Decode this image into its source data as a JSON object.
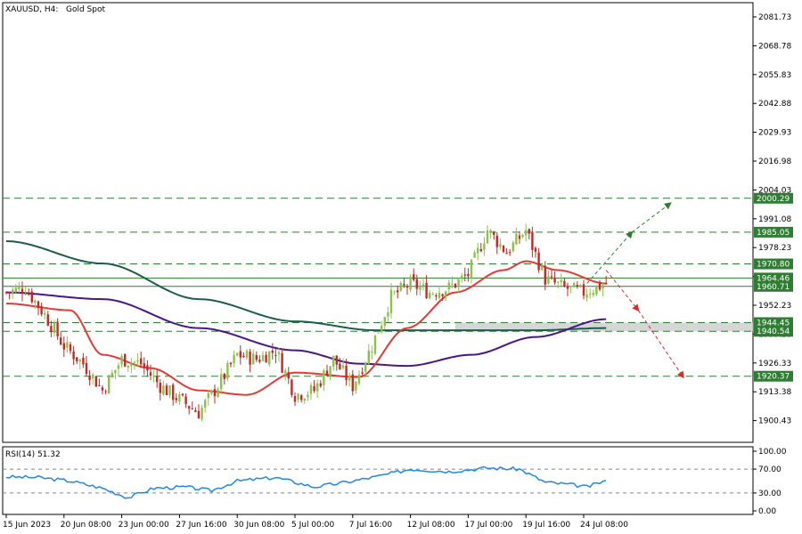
{
  "header": {
    "symbol": "XAUUSD, H4:",
    "description": "Gold Spot"
  },
  "colors": {
    "candle_up": "#8bc34a",
    "candle_down": "#c62828",
    "ma_fast": "#e53935",
    "ma_mid": "#4a148c",
    "ma_slow": "#1b5e4f",
    "level_line": "#2e7d32",
    "badge_fill": "#2e7d32",
    "zone_fill": "#cfcfcf",
    "rsi_line": "#1e88e5",
    "arrow_up": "#2e7d32",
    "arrow_down": "#d32f2f"
  },
  "chart_data": {
    "type": "candlestick",
    "price_axis": {
      "ticks": [
        "2081.73",
        "2068.78",
        "2055.83",
        "2042.88",
        "2029.93",
        "2016.98",
        "2004.03",
        "1991.08",
        "1978.23",
        "1965.28",
        "1952.23",
        "1939.28",
        "1926.33",
        "1913.38",
        "1900.43"
      ],
      "ylim": [
        1888,
        2087
      ]
    },
    "time_axis": {
      "labels": [
        "15 Jun 2023",
        "20 Jun 08:00",
        "23 Jun 00:00",
        "27 Jun 16:00",
        "30 Jun 08:00",
        "5 Jul 00:00",
        "7 Jul 16:00",
        "12 Jul 08:00",
        "17 Jul 00:00",
        "19 Jul 16:00",
        "24 Jul 08:00"
      ]
    },
    "levels": [
      {
        "value": 2000.29,
        "label": "2000.29",
        "style": "dashed"
      },
      {
        "value": 1985.05,
        "label": "1985.05",
        "style": "dashed"
      },
      {
        "value": 1970.8,
        "label": "1970.80",
        "style": "dashed"
      },
      {
        "value": 1964.46,
        "label": "1964.46",
        "style": "solid"
      },
      {
        "value": 1960.71,
        "label": "1960.71",
        "style": "solid"
      },
      {
        "value": 1944.45,
        "label": "1944.45",
        "style": "dashed"
      },
      {
        "value": 1940.54,
        "label": "1940.54",
        "style": "dashed"
      },
      {
        "value": 1920.37,
        "label": "1920.37",
        "style": "dashed"
      }
    ],
    "zone": {
      "from": 1940.54,
      "to": 1944.45
    },
    "anchors": [
      {
        "x": 0,
        "y": 1958
      },
      {
        "x": 6,
        "y": 1960
      },
      {
        "x": 12,
        "y": 1948
      },
      {
        "x": 18,
        "y": 1934
      },
      {
        "x": 24,
        "y": 1926
      },
      {
        "x": 30,
        "y": 1914
      },
      {
        "x": 36,
        "y": 1928
      },
      {
        "x": 42,
        "y": 1926
      },
      {
        "x": 48,
        "y": 1916
      },
      {
        "x": 54,
        "y": 1910
      },
      {
        "x": 60,
        "y": 1904
      },
      {
        "x": 66,
        "y": 1916
      },
      {
        "x": 72,
        "y": 1930
      },
      {
        "x": 78,
        "y": 1928
      },
      {
        "x": 84,
        "y": 1932
      },
      {
        "x": 90,
        "y": 1912
      },
      {
        "x": 96,
        "y": 1914
      },
      {
        "x": 102,
        "y": 1928
      },
      {
        "x": 108,
        "y": 1916
      },
      {
        "x": 114,
        "y": 1934
      },
      {
        "x": 120,
        "y": 1956
      },
      {
        "x": 126,
        "y": 1962
      },
      {
        "x": 132,
        "y": 1958
      },
      {
        "x": 138,
        "y": 1960
      },
      {
        "x": 144,
        "y": 1966
      },
      {
        "x": 150,
        "y": 1986
      },
      {
        "x": 156,
        "y": 1976
      },
      {
        "x": 162,
        "y": 1986
      },
      {
        "x": 168,
        "y": 1964
      },
      {
        "x": 174,
        "y": 1960
      },
      {
        "x": 180,
        "y": 1958
      },
      {
        "x": 187,
        "y": 1962
      }
    ],
    "ma_fast": [
      {
        "x": 0,
        "y": 1953
      },
      {
        "x": 20,
        "y": 1950
      },
      {
        "x": 30,
        "y": 1930
      },
      {
        "x": 45,
        "y": 1924
      },
      {
        "x": 60,
        "y": 1914
      },
      {
        "x": 75,
        "y": 1912
      },
      {
        "x": 90,
        "y": 1922
      },
      {
        "x": 110,
        "y": 1920
      },
      {
        "x": 125,
        "y": 1942
      },
      {
        "x": 140,
        "y": 1958
      },
      {
        "x": 155,
        "y": 1968
      },
      {
        "x": 162,
        "y": 1972
      },
      {
        "x": 172,
        "y": 1968
      },
      {
        "x": 187,
        "y": 1962
      }
    ],
    "ma_mid": [
      {
        "x": 0,
        "y": 1958
      },
      {
        "x": 30,
        "y": 1955
      },
      {
        "x": 60,
        "y": 1942
      },
      {
        "x": 90,
        "y": 1932
      },
      {
        "x": 110,
        "y": 1926
      },
      {
        "x": 125,
        "y": 1925
      },
      {
        "x": 145,
        "y": 1930
      },
      {
        "x": 165,
        "y": 1938
      },
      {
        "x": 187,
        "y": 1946
      }
    ],
    "ma_slow": [
      {
        "x": 0,
        "y": 1981
      },
      {
        "x": 30,
        "y": 1971
      },
      {
        "x": 60,
        "y": 1955
      },
      {
        "x": 90,
        "y": 1945
      },
      {
        "x": 115,
        "y": 1941
      },
      {
        "x": 140,
        "y": 1941
      },
      {
        "x": 165,
        "y": 1941
      },
      {
        "x": 187,
        "y": 1942
      }
    ],
    "projections": {
      "up_short": {
        "from": {
          "x": 181,
          "y": 1962
        },
        "to": {
          "x": 195,
          "y": 1985
        }
      },
      "up_long": {
        "from": {
          "x": 195,
          "y": 1985
        },
        "to": {
          "x": 207,
          "y": 1998
        }
      },
      "down_short": {
        "from": {
          "x": 187,
          "y": 1968
        },
        "to": {
          "x": 197,
          "y": 1950
        }
      },
      "down_long": {
        "from": {
          "x": 197,
          "y": 1950
        },
        "to": {
          "x": 211,
          "y": 1920
        }
      }
    },
    "rsi": {
      "label": "RSI(14) 51.32",
      "ticks": [
        "100.00",
        "70.00",
        "30.00",
        "0.00"
      ],
      "levels": [
        70,
        30
      ],
      "points": [
        {
          "x": 0,
          "y": 57
        },
        {
          "x": 10,
          "y": 56
        },
        {
          "x": 20,
          "y": 50
        },
        {
          "x": 30,
          "y": 38
        },
        {
          "x": 38,
          "y": 22
        },
        {
          "x": 46,
          "y": 38
        },
        {
          "x": 56,
          "y": 40
        },
        {
          "x": 64,
          "y": 34
        },
        {
          "x": 72,
          "y": 50
        },
        {
          "x": 84,
          "y": 56
        },
        {
          "x": 96,
          "y": 40
        },
        {
          "x": 106,
          "y": 48
        },
        {
          "x": 116,
          "y": 58
        },
        {
          "x": 126,
          "y": 70
        },
        {
          "x": 138,
          "y": 66
        },
        {
          "x": 150,
          "y": 72
        },
        {
          "x": 160,
          "y": 70
        },
        {
          "x": 168,
          "y": 48
        },
        {
          "x": 176,
          "y": 44
        },
        {
          "x": 181,
          "y": 40
        },
        {
          "x": 187,
          "y": 51
        }
      ]
    }
  }
}
